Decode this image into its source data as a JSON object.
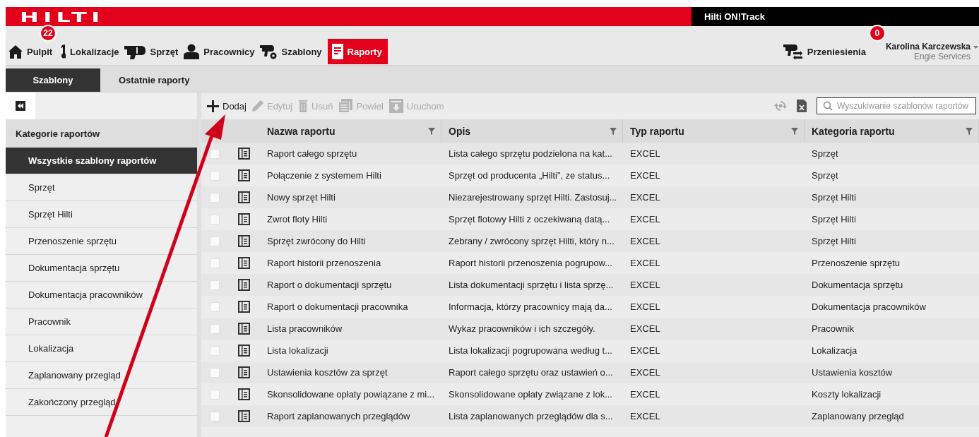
{
  "header": {
    "logo": "HILTI",
    "app_title": "Hilti ON!Track"
  },
  "nav": {
    "items": [
      {
        "kind": "home",
        "label": "Pulpit",
        "badge": "22",
        "selected": false
      },
      {
        "kind": "pin",
        "label": "Lokalizacje",
        "selected": false
      },
      {
        "kind": "drill",
        "label": "Sprzęt",
        "selected": false
      },
      {
        "kind": "person",
        "label": "Pracownicy",
        "selected": false
      },
      {
        "kind": "template",
        "label": "Szablony",
        "selected": false
      },
      {
        "kind": "report",
        "label": "Raporty",
        "selected": true
      }
    ],
    "transfers": {
      "label": "Przeniesienia",
      "badge": "0"
    },
    "user": {
      "name": "Karolina Karczewska",
      "company": "Engie Services"
    }
  },
  "subtabs": [
    {
      "label": "Szablony",
      "selected": true
    },
    {
      "label": "Ostatnie raporty",
      "selected": false
    }
  ],
  "sidebar": {
    "title": "Kategorie raportów",
    "items": [
      {
        "label": "Wszystkie szablony raportów",
        "selected": true
      },
      {
        "label": "Sprzęt",
        "selected": false
      },
      {
        "label": "Sprzęt Hilti",
        "selected": false
      },
      {
        "label": "Przenoszenie sprzętu",
        "selected": false
      },
      {
        "label": "Dokumentacja sprzętu",
        "selected": false
      },
      {
        "label": "Dokumentacja pracowników",
        "selected": false
      },
      {
        "label": "Pracownik",
        "selected": false
      },
      {
        "label": "Lokalizacja",
        "selected": false
      },
      {
        "label": "Zaplanowany przegląd",
        "selected": false
      },
      {
        "label": "Zakończony przegląd",
        "selected": false
      }
    ]
  },
  "toolbar": {
    "buttons": [
      {
        "kind": "add",
        "label": "Dodaj",
        "disabled": false
      },
      {
        "kind": "edit",
        "label": "Edytuj",
        "disabled": true
      },
      {
        "kind": "delete",
        "label": "Usuń",
        "disabled": true
      },
      {
        "kind": "copy",
        "label": "Powiel",
        "disabled": true
      },
      {
        "kind": "run",
        "label": "Uruchom",
        "disabled": true
      }
    ],
    "search": {
      "placeholder": "Wyszukiwanie szablonów raportów"
    }
  },
  "table": {
    "columns": [
      "Nazwa raportu",
      "Opis",
      "Typ raportu",
      "Kategoria raportu"
    ],
    "rows": [
      {
        "selected": false,
        "cells": [
          "Raport całego sprzętu",
          "Lista całego sprzętu podzielona na kat...",
          "EXCEL",
          "Sprzęt"
        ]
      },
      {
        "selected": false,
        "cells": [
          "Połączenie z systemem Hilti",
          "Sprzęt od producenta „Hilti”, ze status...",
          "EXCEL",
          "Sprzęt"
        ]
      },
      {
        "selected": false,
        "cells": [
          "Nowy sprzęt Hilti",
          "Niezarejestrowany sprzęt Hilti. Zastosuj...",
          "EXCEL",
          "Sprzęt Hilti"
        ]
      },
      {
        "selected": false,
        "cells": [
          "Zwrot floty Hilti",
          "Sprzęt flotowy Hilti z oczekiwaną datą...",
          "EXCEL",
          "Sprzęt Hilti"
        ]
      },
      {
        "selected": false,
        "cells": [
          "Sprzęt zwrócony do Hilti",
          "Zebrany / zwrócony sprzęt Hilti, który n...",
          "EXCEL",
          "Sprzęt Hilti"
        ]
      },
      {
        "selected": false,
        "cells": [
          "Raport historii przenoszenia",
          "Raport historii przenoszenia pogrupow...",
          "EXCEL",
          "Przenoszenie sprzętu"
        ]
      },
      {
        "selected": false,
        "cells": [
          "Raport o dokumentacji sprzętu",
          "Lista dokumentacji sprzętu i lista sprzę...",
          "EXCEL",
          "Dokumentacja sprzętu"
        ]
      },
      {
        "selected": false,
        "cells": [
          "Raport o dokumentacji pracownika",
          "Informacja, którzy pracownicy mają da...",
          "EXCEL",
          "Dokumentacja pracowników"
        ]
      },
      {
        "selected": false,
        "cells": [
          "Lista pracowników",
          "Wykaz pracowników i ich szczegóły.",
          "EXCEL",
          "Pracownik"
        ]
      },
      {
        "selected": false,
        "cells": [
          "Lista lokalizacji",
          "Lista lokalizacji pogrupowana według t...",
          "EXCEL",
          "Lokalizacja"
        ]
      },
      {
        "selected": false,
        "cells": [
          "Ustawienia kosztów za sprzęt",
          "Raport całego sprzętu oraz ustawień o...",
          "EXCEL",
          "Ustawienia kosztów"
        ]
      },
      {
        "selected": false,
        "cells": [
          "Skonsolidowane opłaty powiązane z mi...",
          "Skonsolidowane opłaty związane z lok...",
          "EXCEL",
          "Koszty lokalizacji"
        ]
      },
      {
        "selected": false,
        "cells": [
          "Raport zaplanowanych przeglądów",
          "Lista zaplanowanych przeglądów dla s...",
          "EXCEL",
          "Zaplanowany przegląd"
        ]
      }
    ]
  }
}
